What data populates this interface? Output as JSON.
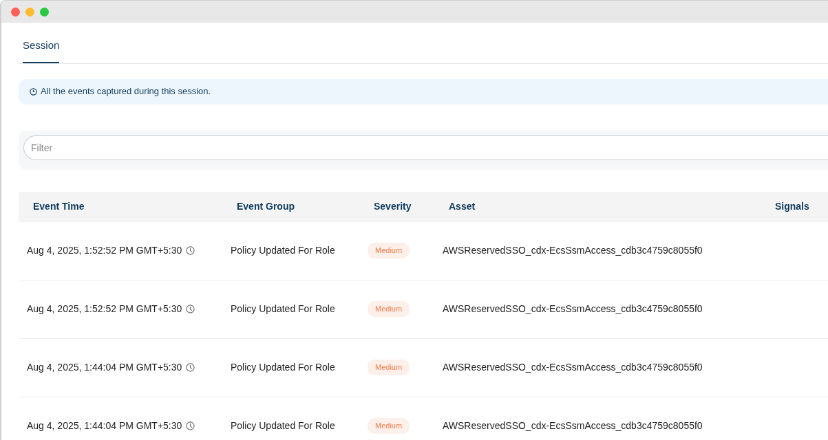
{
  "tabs": [
    {
      "label": "Session",
      "selected": true
    }
  ],
  "info_banner": {
    "text": "All the events captured during this session."
  },
  "filter": {
    "placeholder": "Filter"
  },
  "table": {
    "columns": [
      "Event Time",
      "Event Group",
      "Severity",
      "Asset",
      "Signals"
    ],
    "rows": [
      {
        "event_time": "Aug 4, 2025, 1:52:52 PM GMT+5:30",
        "event_group": "Policy Updated For Role",
        "severity": "Medium",
        "asset": "AWSReservedSSO_cdx-EcsSsmAccess_cdb3c4759c8055f0"
      },
      {
        "event_time": "Aug 4, 2025, 1:52:52 PM GMT+5:30",
        "event_group": "Policy Updated For Role",
        "severity": "Medium",
        "asset": "AWSReservedSSO_cdx-EcsSsmAccess_cdb3c4759c8055f0"
      },
      {
        "event_time": "Aug 4, 2025, 1:44:04 PM GMT+5:30",
        "event_group": "Policy Updated For Role",
        "severity": "Medium",
        "asset": "AWSReservedSSO_cdx-EcsSsmAccess_cdb3c4759c8055f0"
      },
      {
        "event_time": "Aug 4, 2025, 1:44:04 PM GMT+5:30",
        "event_group": "Policy Updated For Role",
        "severity": "Medium",
        "asset": "AWSReservedSSO_cdx-EcsSsmAccess_cdb3c4759c8055f0"
      }
    ]
  }
}
